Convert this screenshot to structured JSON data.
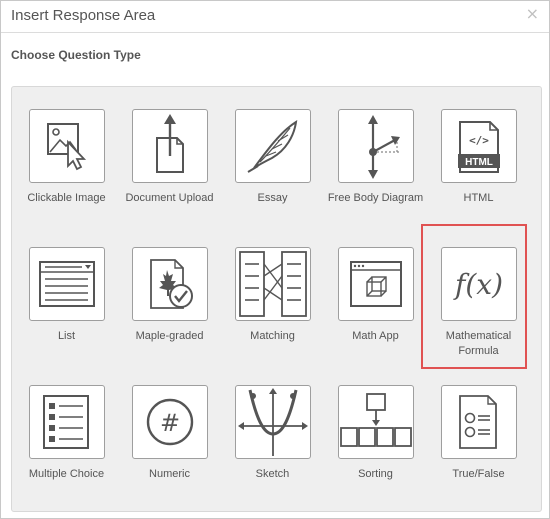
{
  "dialog": {
    "title": "Insert Response Area",
    "close_symbol": "×",
    "section_title": "Choose Question Type",
    "highlight_color": "#e05252"
  },
  "types": [
    {
      "label": "Clickable Image",
      "icon": "clickable-image-icon"
    },
    {
      "label": "Document Upload",
      "icon": "document-upload-icon"
    },
    {
      "label": "Essay",
      "icon": "feather-pen-icon"
    },
    {
      "label": "Free Body Diagram",
      "icon": "free-body-diagram-icon"
    },
    {
      "label": "HTML",
      "icon": "html-file-icon"
    },
    {
      "label": "List",
      "icon": "list-dropdown-icon"
    },
    {
      "label": "Maple-graded",
      "icon": "maple-leaf-check-icon"
    },
    {
      "label": "Matching",
      "icon": "matching-icon"
    },
    {
      "label": "Math App",
      "icon": "math-app-cube-icon"
    },
    {
      "label": "Mathematical Formula",
      "icon": "fx-formula-icon",
      "selected": true
    },
    {
      "label": "Multiple Choice",
      "icon": "multiple-choice-icon"
    },
    {
      "label": "Numeric",
      "icon": "hash-circle-icon"
    },
    {
      "label": "Sketch",
      "icon": "sketch-axes-icon"
    },
    {
      "label": "Sorting",
      "icon": "sorting-boxes-icon"
    },
    {
      "label": "True/False",
      "icon": "true-false-icon"
    }
  ]
}
